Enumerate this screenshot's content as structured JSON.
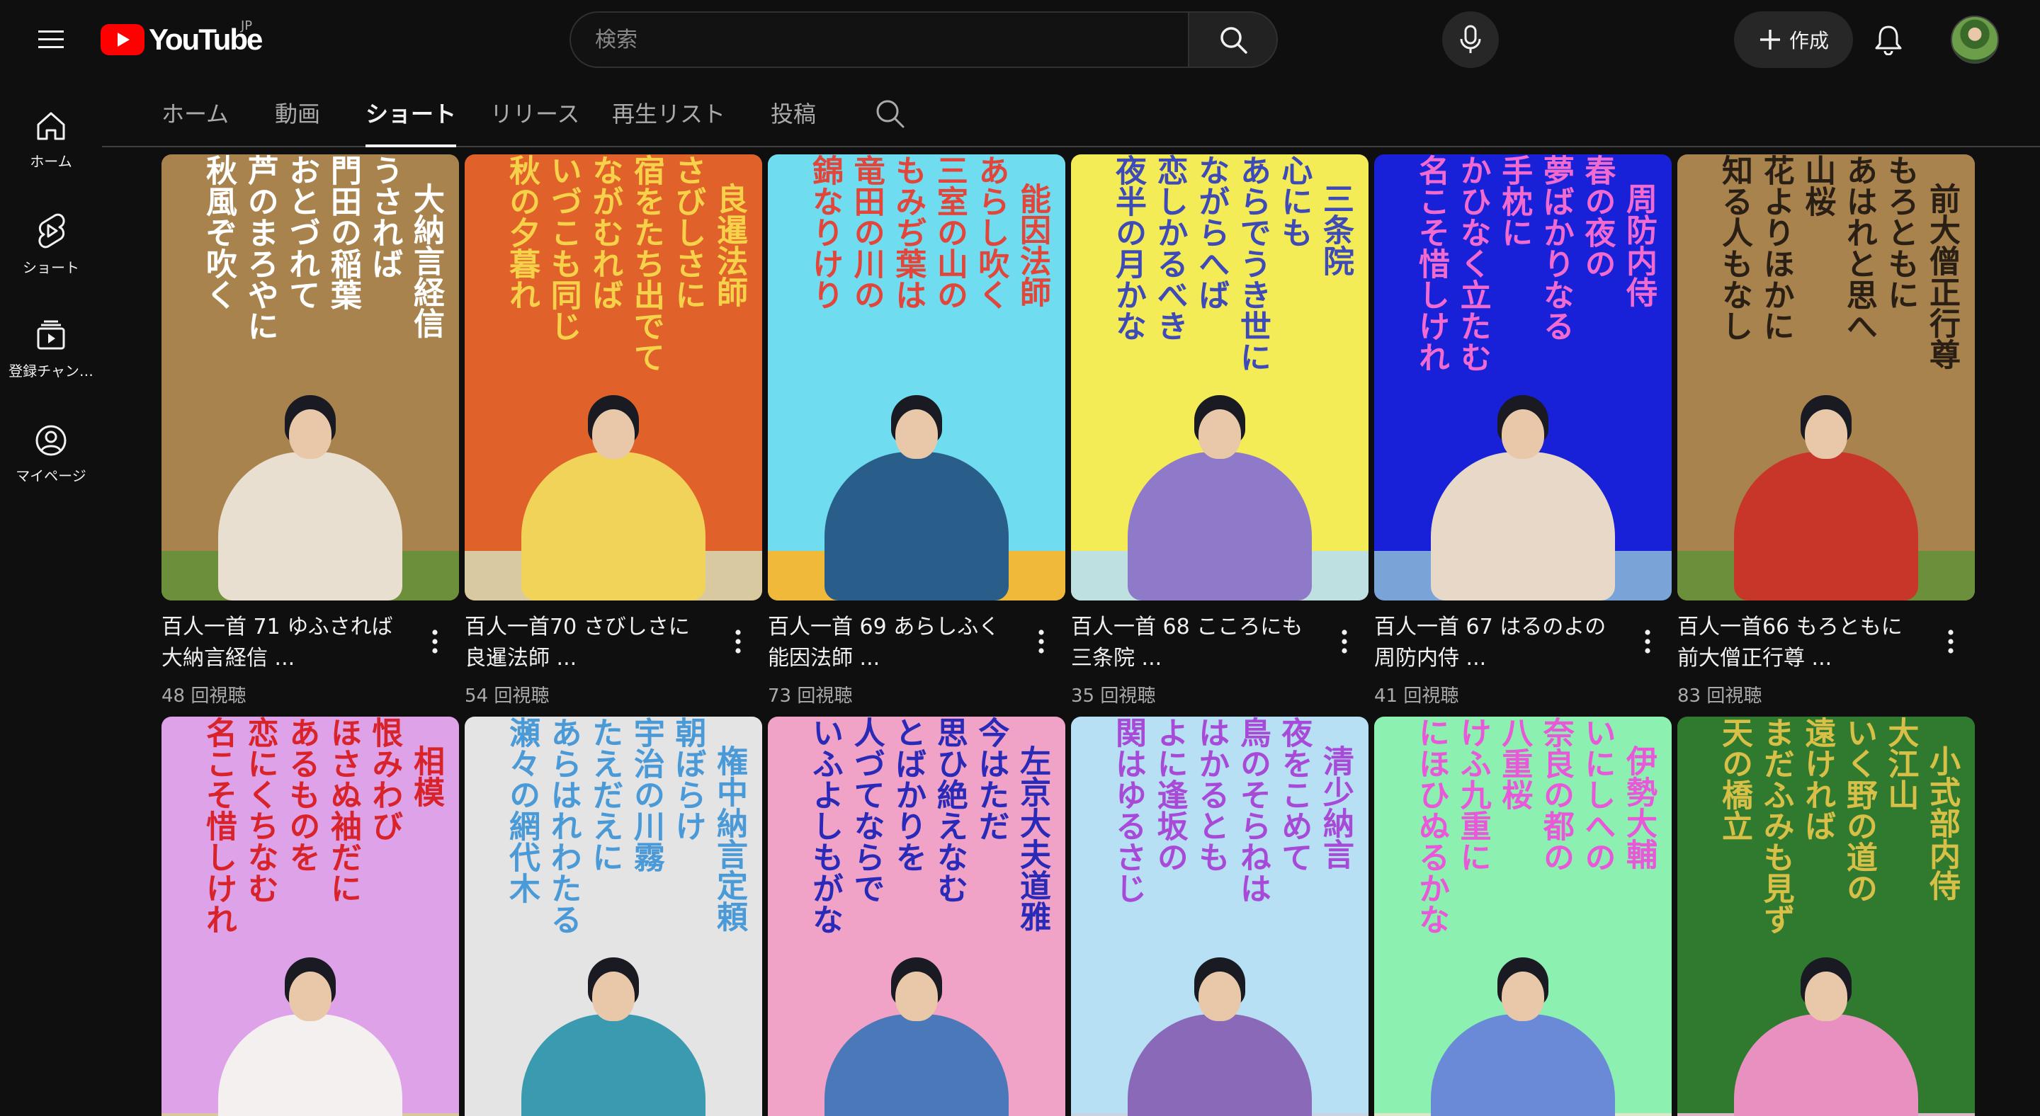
{
  "header": {
    "logo_text": "YouTube",
    "region": "JP",
    "search_placeholder": "検索",
    "create_label": "作成"
  },
  "sidebar": {
    "items": [
      {
        "label": "ホーム",
        "icon": "home-icon"
      },
      {
        "label": "ショート",
        "icon": "shorts-icon"
      },
      {
        "label": "登録チャン…",
        "icon": "subscriptions-icon"
      },
      {
        "label": "マイページ",
        "icon": "you-icon"
      }
    ]
  },
  "tabs": [
    {
      "label": "ホーム",
      "active": false
    },
    {
      "label": "動画",
      "active": false
    },
    {
      "label": "ショート",
      "active": true
    },
    {
      "label": "リリース",
      "active": false
    },
    {
      "label": "再生リスト",
      "active": false
    },
    {
      "label": "投稿",
      "active": false
    }
  ],
  "shorts": [
    {
      "title_line1": "百人一首 71 ゆふされば",
      "title_line2": "大納言経信 ...",
      "views": "48 回視聴",
      "bg": "#a9834e",
      "ink": "#ffffff",
      "ground": "#6b8f3a",
      "robe": "#e9dfd0",
      "poem": [
        "大納言経信",
        "うされば",
        "門田の稲葉",
        "おとづれて",
        "芦のまろやに",
        "秋風ぞ吹く"
      ]
    },
    {
      "title_line1": "百人一首70 さびしさに",
      "title_line2": "良暹法師 ...",
      "views": "54 回視聴",
      "bg": "#e0622a",
      "ink": "#f6d24a",
      "ground": "#d9c9a0",
      "robe": "#f2d35a",
      "poem": [
        "良暹法師",
        "さびしさに",
        "宿をたち出でて",
        "ながむれば",
        "いづこも同じ",
        "秋の夕暮れ"
      ]
    },
    {
      "title_line1": "百人一首 69 あらしふく",
      "title_line2": "能因法師 ...",
      "views": "73 回視聴",
      "bg": "#6fdcf0",
      "ink": "#e2453a",
      "ground": "#f0b93a",
      "robe": "#2a5e8a",
      "poem": [
        "能因法師",
        "あらし吹く",
        "三室の山の",
        "もみぢ葉は",
        "竜田の川の",
        "錦なりけり"
      ]
    },
    {
      "title_line1": "百人一首 68 こころにも",
      "title_line2": "三条院 ...",
      "views": "35 回視聴",
      "bg": "#f4ec57",
      "ink": "#3d4ab8",
      "ground": "#bfe0e0",
      "robe": "#8e7ac8",
      "poem": [
        "三条院",
        "心にも",
        "あらでうき世に",
        "ながらへば",
        "恋しかるべき",
        "夜半の月かな"
      ]
    },
    {
      "title_line1": "百人一首 67 はるのよの",
      "title_line2": "周防内侍 ...",
      "views": "41 回視聴",
      "bg": "#1820d8",
      "ink": "#f06ad0",
      "ground": "#7aa3d8",
      "robe": "#e8d8c8",
      "poem": [
        "周防内侍",
        "春の夜の",
        "夢ばかりなる",
        "手枕に",
        "かひなく立たむ",
        "名こそ惜しけれ"
      ]
    },
    {
      "title_line1": "百人一首66 もろともに",
      "title_line2": "前大僧正行尊 ...",
      "views": "83 回視聴",
      "bg": "#a9834e",
      "ink": "#2a1f14",
      "ground": "#6b8f3a",
      "robe": "#c8362a",
      "poem": [
        "前大僧正行尊",
        "もろともに",
        "あはれと思へ",
        "山桜",
        "花よりほかに",
        "知る人もなし"
      ]
    },
    {
      "title_line1": "",
      "title_line2": "",
      "views": "",
      "bg": "#dda2e8",
      "ink": "#d8232a",
      "ground": "#d8c8a0",
      "robe": "#f4f0f0",
      "poem": [
        "相模",
        "恨みわび",
        "ほさぬ袖だに",
        "あるものを",
        "恋にくちなむ",
        "名こそ惜しけれ"
      ]
    },
    {
      "title_line1": "",
      "title_line2": "",
      "views": "",
      "bg": "#e4e4e4",
      "ink": "#4a9ad8",
      "ground": "#e4e4e4",
      "robe": "#3a9ab0",
      "poem": [
        "権中納言定頼",
        "朝ぼらけ",
        "宇治の川霧",
        "たえだえに",
        "あらはれわたる",
        "瀬々の網代木"
      ]
    },
    {
      "title_line1": "",
      "title_line2": "",
      "views": "",
      "bg": "#f0a3c6",
      "ink": "#2a2ab8",
      "ground": "#f0a3c6",
      "robe": "#4a78b8",
      "poem": [
        "左京大夫道雅",
        "今はただ",
        "思ひ絶えなむ",
        "とばかりを",
        "人づてならで",
        "いふよしもがな"
      ]
    },
    {
      "title_line1": "",
      "title_line2": "",
      "views": "",
      "bg": "#b8e0f4",
      "ink": "#a84ad8",
      "ground": "#c8d4e0",
      "robe": "#8a6ab8",
      "poem": [
        "清少納言",
        "夜をこめて",
        "鳥のそらねは",
        "はかるとも",
        "よに逢坂の",
        "関はゆるさじ"
      ]
    },
    {
      "title_line1": "",
      "title_line2": "",
      "views": "",
      "bg": "#8cf0b0",
      "ink": "#e858d8",
      "ground": "#d8e8c8",
      "robe": "#6a8ad8",
      "poem": [
        "伊勢大輔",
        "いにしへの",
        "奈良の都の",
        "八重桜",
        "けふ九重に",
        "にほひぬるかな"
      ]
    },
    {
      "title_line1": "",
      "title_line2": "",
      "views": "",
      "bg": "#2f7a2e",
      "ink": "#d8c048",
      "ground": "#d8b8c8",
      "robe": "#e890c0",
      "poem": [
        "小式部内侍",
        "大江山",
        "いく野の道の",
        "遠ければ",
        "まだふみも見ず",
        "天の橋立"
      ]
    }
  ],
  "colors": {
    "background": "#0f0f0f",
    "brand_red": "#ff0000",
    "text": "#f1f1f1",
    "secondary_text": "#aaaaaa"
  }
}
